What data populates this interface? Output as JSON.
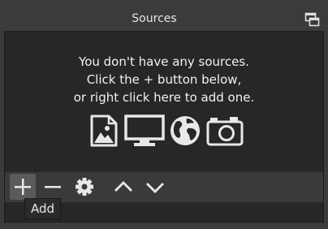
{
  "dock": {
    "title": "Sources",
    "float_icon": "undock-icon"
  },
  "empty_state": {
    "line1": "You don't have any sources.",
    "line2": "Click the + button below,",
    "line3": "or right click here to add one.",
    "icons": [
      "image-icon",
      "monitor-icon",
      "globe-icon",
      "camera-icon"
    ]
  },
  "toolbar": {
    "buttons": [
      "add-icon",
      "remove-icon",
      "gear-icon",
      "chevron-up-icon",
      "chevron-down-icon"
    ]
  },
  "tooltip": {
    "text": "Add"
  },
  "colors": {
    "panel_bg": "#272727",
    "dock_bg": "#3b3b3b",
    "icon": "#e8e8e8"
  }
}
